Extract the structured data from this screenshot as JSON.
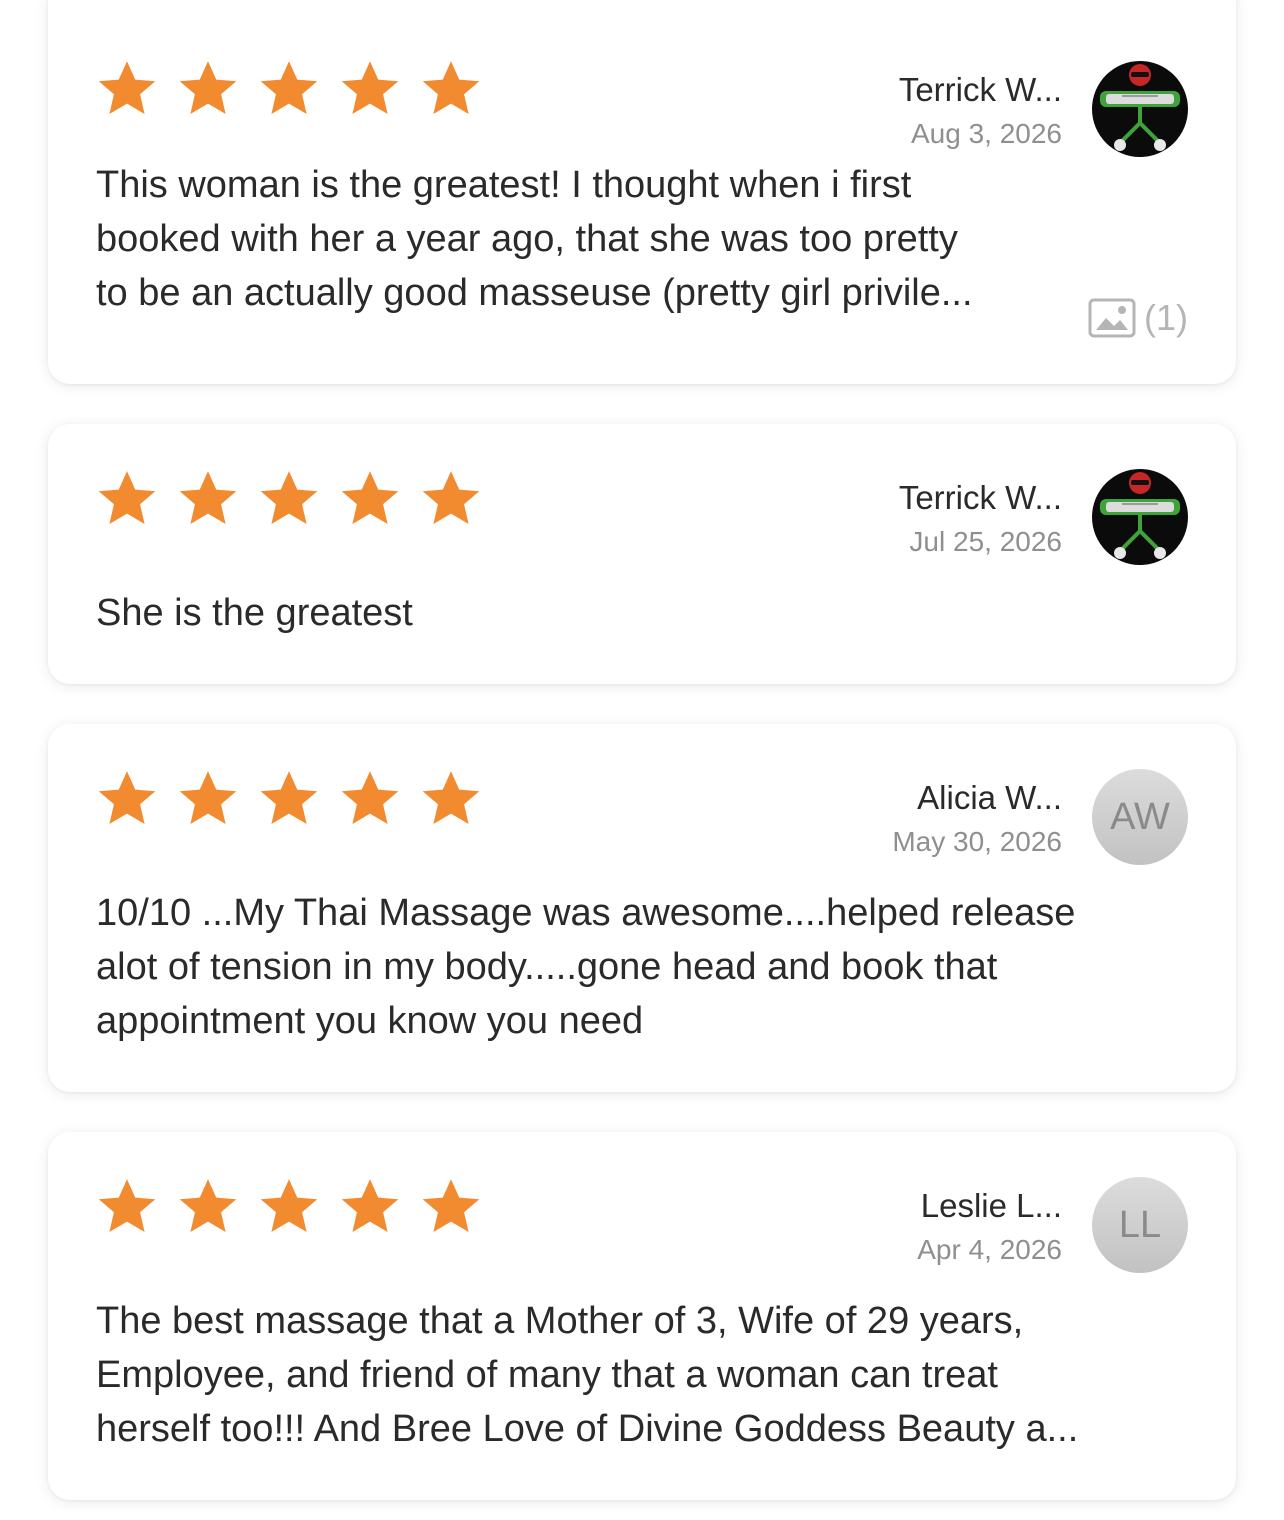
{
  "colors": {
    "star": "#f28b30",
    "text": "#2a2a2a",
    "muted": "#8f8f8f",
    "avatar_gray": "#c9c9c9"
  },
  "reviews": [
    {
      "rating": 5,
      "reviewer": "Terrick W...",
      "date": "Aug 3, 2026",
      "avatar": "photo-avatar",
      "text_lines": [
        "This woman is the greatest! I thought when i first",
        "booked with her a year ago, that she was too pretty",
        "to be an actually good masseuse (pretty girl privile..."
      ],
      "photos": "(1)",
      "photo_icon": "image-icon"
    },
    {
      "rating": 5,
      "reviewer": "Terrick W...",
      "date": "Jul 25, 2026",
      "avatar": "photo-avatar",
      "text_lines": [
        "She is the greatest"
      ]
    },
    {
      "rating": 5,
      "reviewer": "Alicia W...",
      "date": "May 30, 2026",
      "avatar_initials": "AW",
      "text_lines": [
        "10/10 ...My Thai Massage was awesome....helped release",
        "alot of tension in my body.....gone head and book that",
        "appointment you know you need"
      ]
    },
    {
      "rating": 5,
      "reviewer": "Leslie L...",
      "date": "Apr 4, 2026",
      "avatar_initials": "LL",
      "text_lines": [
        "The best massage that a Mother of 3, Wife of 29 years,",
        "Employee, and friend of many that a woman can treat",
        "herself too!!! And Bree Love of Divine Goddess Beauty a..."
      ]
    }
  ]
}
